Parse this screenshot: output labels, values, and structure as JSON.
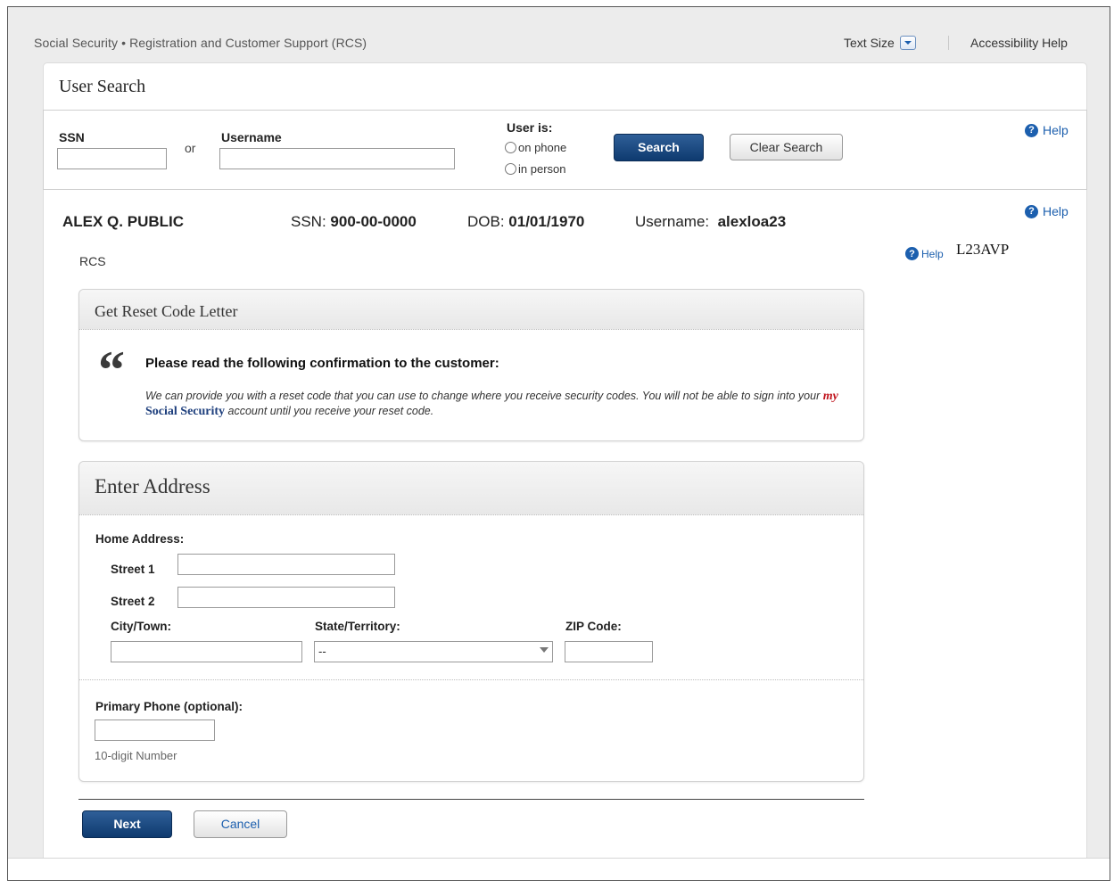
{
  "header": {
    "app_title": "Social Security • Registration and Customer Support (RCS)",
    "text_size_label": "Text Size",
    "accessibility_help": "Accessibility Help"
  },
  "user_search": {
    "title": "User Search",
    "ssn_label": "SSN",
    "ssn_value": "",
    "or_label": "or",
    "username_label": "Username",
    "username_value": "",
    "user_is_label": "User is:",
    "options": [
      "on phone",
      "in person"
    ],
    "search_button": "Search",
    "clear_button": "Clear Search",
    "help": "Help"
  },
  "person": {
    "name": "ALEX Q. PUBLIC",
    "ssn_label": "SSN:",
    "ssn": "900-00-0000",
    "dob_label": "DOB:",
    "dob": "01/01/1970",
    "username_label": "Username:",
    "username": "alexloa23",
    "help": "Help",
    "rcs": "RCS",
    "tag_help": "Help",
    "tag_code": "L23AVP"
  },
  "reset_panel": {
    "title": "Get Reset Code Letter",
    "quote_mark": "“",
    "instruction": "Please read the following confirmation to the customer:",
    "body_part1": "We can provide you with a reset code that you can use to change where you receive security codes.   You will not be able to sign into your",
    "my": "my",
    "social_security": "Social Security",
    "body_part2": "account until you receive your reset code."
  },
  "address_panel": {
    "title": "Enter Address",
    "home_address_label": "Home Address:",
    "street1_label": "Street 1",
    "street1_value": "",
    "street2_label": "Street 2",
    "street2_value": "",
    "city_label": "City/Town:",
    "city_value": "",
    "state_label": "State/Territory:",
    "state_value": "--",
    "zip_label": "ZIP Code:",
    "zip_value": "",
    "phone_label": "Primary Phone (optional):",
    "phone_value": "",
    "phone_hint": "10-digit Number"
  },
  "actions": {
    "next": "Next",
    "cancel": "Cancel"
  }
}
